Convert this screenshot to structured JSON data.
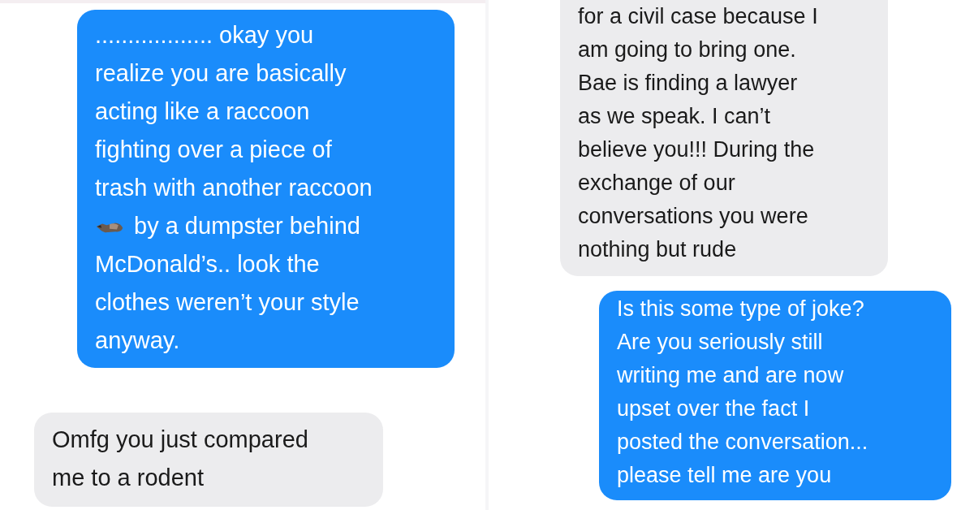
{
  "panels": [
    {
      "messages": [
        {
          "kind": "sent",
          "segments": [
            {
              "kind": "text",
              "text": ".................. okay you\nrealize you are basically\nacting like a raccoon\nfighting over a piece of\ntrash with another raccoon"
            },
            {
              "kind": "icon_line",
              "text": "by a dumpster behind"
            },
            {
              "kind": "text",
              "text": "McDonald’s.. look the\nclothes weren’t your style\nanyway."
            }
          ]
        },
        {
          "kind": "received",
          "segments": [
            {
              "kind": "text",
              "text": "Omfg you just compared\nme to a rodent"
            }
          ]
        }
      ]
    },
    {
      "messages": [
        {
          "kind": "received",
          "segments": [
            {
              "kind": "text",
              "text": "for a civil case because I\nam going to bring one.\nBae is finding a lawyer\nas we speak. I can’t\nbelieve you!!! During the\nexchange of our\nconversations you were\nnothing but rude"
            }
          ]
        },
        {
          "kind": "sent",
          "segments": [
            {
              "kind": "text",
              "text": "Is this some type of joke?\nAre you seriously still\nwriting me and are now\nupset over the fact I\nposted the conversation...\nplease tell me are you"
            }
          ]
        }
      ]
    }
  ]
}
